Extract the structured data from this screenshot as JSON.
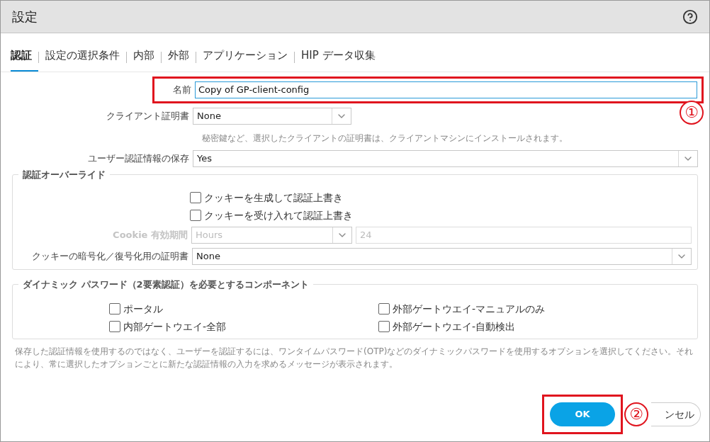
{
  "dialog": {
    "title": "設定"
  },
  "tabs": [
    {
      "label": "認証",
      "selected": true
    },
    {
      "label": "設定の選択条件",
      "selected": false
    },
    {
      "label": "内部",
      "selected": false
    },
    {
      "label": "外部",
      "selected": false
    },
    {
      "label": "アプリケーション",
      "selected": false
    },
    {
      "label": "HIP データ収集",
      "selected": false
    }
  ],
  "fields": [
    {
      "kind": "text",
      "label": "名前",
      "value": "Copy of GP-client-config",
      "annotation": "①"
    },
    {
      "kind": "select_short",
      "label": "クライアント証明書",
      "value": "None"
    },
    {
      "kind": "hint",
      "text": "秘密鍵など、選択したクライアントの証明書は、クライアントマシンにインストールされます。"
    },
    {
      "kind": "select",
      "label": "ユーザー認証情報の保存",
      "value": "Yes"
    }
  ],
  "override": {
    "legend": "認証オーバーライド",
    "checkboxes": [
      {
        "label": "クッキーを生成して認証上書き",
        "checked": false
      },
      {
        "label": "クッキーを受け入れて認証上書き",
        "checked": false
      }
    ],
    "cookie_lifetime": {
      "label": "Cookie 有効期間",
      "unit": "Hours",
      "value": "24",
      "disabled": true
    },
    "certificate": {
      "label": "クッキーの暗号化／復号化用の証明書",
      "value": "None"
    }
  },
  "dynamic_password": {
    "legend": "ダイナミック パスワード（2要素認証）を必要とするコンポーネント",
    "options": [
      {
        "label": "ポータル",
        "checked": false
      },
      {
        "label": "内部ゲートウエイ-全部",
        "checked": false
      },
      {
        "label": "外部ゲートウエイ-マニュアルのみ",
        "checked": false
      },
      {
        "label": "外部ゲートウエイ-自動検出",
        "checked": false
      }
    ]
  },
  "note": "保存した認証情報を使用するのではなく、ユーザーを認証するには、ワンタイムパスワード(OTP)などのダイナミックパスワードを使用するオプションを選択してください。それにより、常に選択したオプションごとに新たな認証情報の入力を求めるメッセージが表示されます。",
  "buttons": [
    {
      "kind": "primary",
      "label": "OK",
      "annotation": "②"
    },
    {
      "kind": "secondary",
      "label": "ンセル"
    }
  ]
}
